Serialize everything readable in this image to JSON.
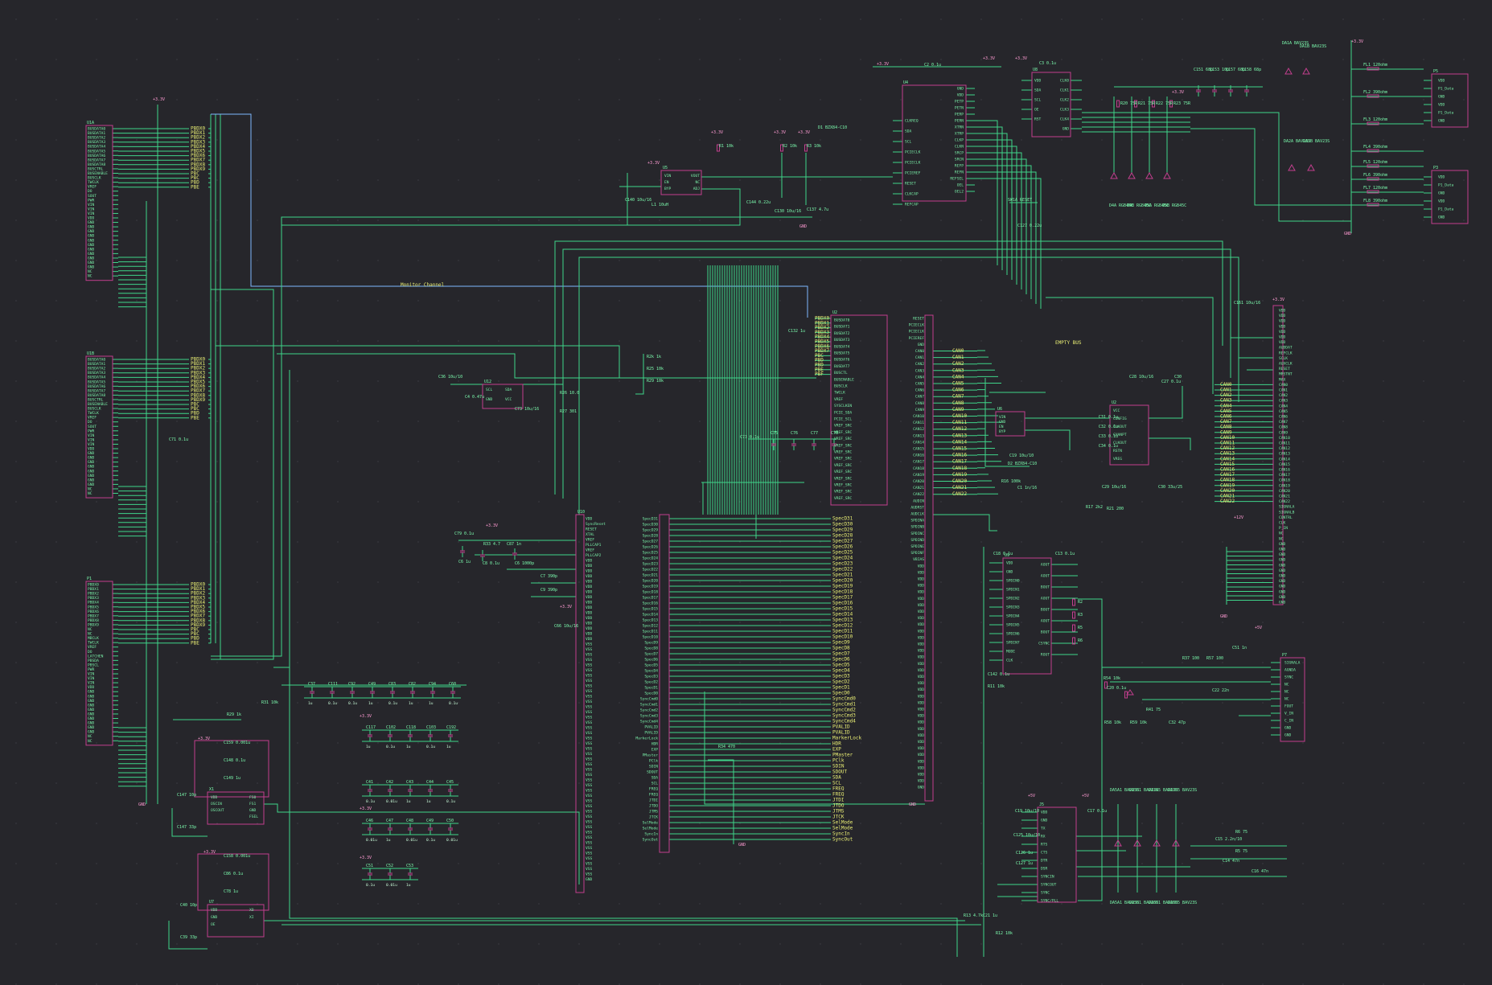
{
  "colors": {
    "background": "#26262b",
    "wire": "#3fd58a",
    "bus": "#7fb8ff",
    "component": "#c23f8e",
    "pin_text": "#79f0a8",
    "ref_text": "#7dffb0",
    "label_text": "#e9ee74",
    "power_text": "#ff9bd3"
  },
  "labels": {
    "monitor_channel": "Monitor Channel",
    "empty_bus": "EMPTY BUS",
    "plus33": "+3.3V",
    "plus5": "+5V",
    "plus12": "+12V",
    "gnd": "GND"
  },
  "power": {
    "top_left": "+3.3V",
    "u4_feed": "+3.3V",
    "reg_left": "+3.3V",
    "r2_feed": "+3.3V",
    "r3_feed": "+3.3V",
    "r4_feed": "+3.3V",
    "r5_feed": "+3.3V",
    "conn_left": "+3.3V",
    "conn_right": "+3.3V",
    "led_feed": "+3.3V",
    "pll_feed": "+3.3V",
    "mcu_feed": "+3.3V",
    "amp_feed": "+5V",
    "amp_feed2": "+5V",
    "p12": "+12V",
    "xtal1": "+3.3V",
    "xtal2": "+3.3V",
    "cap_bank1": "+3.3V",
    "cap_bank2": "+3.3V",
    "cap_bank3": "+3.3V",
    "right_conn": "+3.3V",
    "gnd1": "GND",
    "gnd2": "GND",
    "gnd3": "GND",
    "gnd4": "GND",
    "gnd5": "GND",
    "gnd6": "GND"
  },
  "components": {
    "bus_a": {
      "ref": "U1A",
      "pins": [
        "BUSDATA0",
        "BUSDATA1",
        "BUSDATA2",
        "BUSDATA3",
        "BUSDATA4",
        "BUSDATA5",
        "BUSDATA6",
        "BUSDATA7",
        "BUSDATA8",
        "BUSCTRL",
        "BUSENABLE",
        "BUSCLK",
        "TWCLK",
        "VREF",
        "DO",
        "SOUT",
        "PWR",
        "VIN",
        "VIN",
        "VIN",
        "VDD",
        "GND",
        "GND",
        "GND",
        "GND",
        "GND",
        "GND",
        "GND",
        "GND",
        "GND",
        "GND",
        "GND",
        "NC",
        "NC"
      ]
    },
    "bus_b": {
      "ref": "U1B",
      "pins": [
        "BUSDATA0",
        "BUSDATA1",
        "BUSDATA2",
        "BUSDATA3",
        "BUSDATA4",
        "BUSDATA5",
        "BUSDATA6",
        "BUSDATA7",
        "BUSDATA8",
        "BUSCTRL",
        "BUSENABLE",
        "BUSCLK",
        "TWCLK",
        "VREF",
        "DO",
        "SOUT",
        "PWR",
        "VIN",
        "VIN",
        "VIN",
        "VDD",
        "GND",
        "GND",
        "GND",
        "GND",
        "GND",
        "GND",
        "GND",
        "GND",
        "NC",
        "NC"
      ]
    },
    "bus_c": {
      "ref": "P1",
      "pins": [
        "PBDX0",
        "PBDX1",
        "PBDX2",
        "PBDX3",
        "PBDX4",
        "PBDX5",
        "PBDX6",
        "PBDX7",
        "PBDX8",
        "PBDX9",
        "NC",
        "NC",
        "MBCLK",
        "TWCLK",
        "VREF",
        "DO",
        "LATCHEN",
        "PBSDA",
        "PBSCL",
        "PWR",
        "VIN",
        "VIN",
        "VIN",
        "VDD",
        "GND",
        "GND",
        "GND",
        "GND",
        "GND",
        "GND",
        "GND",
        "GND",
        "GND",
        "GND",
        "NC",
        "NC"
      ]
    },
    "bus_labels_a": [
      "PBDX0",
      "PBDX1",
      "PBDX2",
      "PBDX3",
      "PBDX4",
      "PBDX5",
      "PBDX6",
      "PBDX7",
      "PBDX8",
      "PBDX9",
      "PBC",
      "PBC",
      "PBD",
      "PBE"
    ],
    "bus_labels_b": [
      "PBDX0",
      "PBDX1",
      "PBDX2",
      "PBDX3",
      "PBDX4",
      "PBDX5",
      "PBDX6",
      "PBDX7",
      "PBDX8",
      "PBDX9",
      "PBC",
      "PBC",
      "PBD",
      "PBE"
    ],
    "bus_labels_c": [
      "PBDX0",
      "PBDX1",
      "PBDX2",
      "PBDX3",
      "PBDX4",
      "PBDX5",
      "PBDX6",
      "PBDX7",
      "PBDX8",
      "PBDX9",
      "PBC",
      "PBC",
      "PBD",
      "PBE"
    ],
    "u4": {
      "ref": "U4",
      "pins_left": [
        "CLKREQ",
        "SDA",
        "SCL",
        "PCIECLK",
        "PCIECLK",
        "PCIEREF",
        "RESET",
        "CLKCAP",
        "REFCAP"
      ],
      "pins_right": [
        "GND",
        "VDD",
        "PETP",
        "PETN",
        "PERP",
        "PERN",
        "XTRN",
        "XTRP",
        "CLKP",
        "CLKN",
        "SRCP",
        "SRCN",
        "REFP",
        "REFN",
        "REFSEL",
        "OEL",
        "OEL2"
      ]
    },
    "u8": {
      "ref": "U8",
      "pins_left": [
        "VDD",
        "SDA",
        "SCL",
        "OE",
        "RST"
      ],
      "pins_right": [
        "CLK0",
        "CLK1",
        "CLK2",
        "CLK3",
        "CLK4",
        "GND"
      ]
    },
    "u2": {
      "ref": "U2",
      "pins_left": [
        "PBDX0",
        "PBDX1",
        "PBDX2",
        "PBDX3",
        "PBDX4",
        "PBDX5",
        "PBDX6",
        "PBDX7",
        "PBC",
        "PBD",
        "PBD",
        "PBE",
        "PBF"
      ],
      "pins_right": [
        "BUSDAT0",
        "BUSDAT1",
        "BUSDAT2",
        "BUSDAT3",
        "BUSDAT4",
        "BUSDAT5",
        "BUSDAT6",
        "BUSDAT7",
        "BUSCTL",
        "BUSENABLE",
        "BUSCLK",
        "TWCLK",
        "VREF",
        "SYSCLKEN",
        "PCIE_SDA",
        "PCIE_SCL",
        "VREF_SRC",
        "VREF_SRC",
        "VREF_SRC",
        "VREF_SRC",
        "VREF_SRC",
        "VREF_SRC",
        "VREF_SRC",
        "VREF_SRC",
        "VREF_SRC",
        "VREF_SRC",
        "VREF_SRC",
        "VREF_SRC"
      ]
    },
    "u3": {
      "ref": "U3",
      "pins": [
        "RESET",
        "PCIECLK",
        "PCIECLK",
        "PCIEREF",
        "GND",
        "CAN0",
        "CAN1",
        "CAN2",
        "CAN3",
        "CAN4",
        "CAN5",
        "CAN6",
        "CAN7",
        "CAN8",
        "CAN9",
        "CAN10",
        "CAN11",
        "CAN12",
        "CAN13",
        "CAN14",
        "CAN15",
        "CAN16",
        "CAN17",
        "CAN18",
        "CAN19",
        "CAN20",
        "CAN21",
        "CAN22",
        "AUDIN",
        "AUDRST",
        "AUDCLK",
        "SPDINA",
        "SPDINB",
        "SPDINC",
        "SPDIND",
        "SPDINE",
        "SPDINF",
        "VBIAS",
        "VDD",
        "VDD",
        "VDD",
        "VDD",
        "VDD",
        "VDD",
        "VDD",
        "VDD",
        "VDD",
        "VDD",
        "VDD",
        "VDD",
        "VDD",
        "VDD",
        "VDD",
        "VDD",
        "VDD",
        "VDD",
        "VDD",
        "VDD",
        "VDD",
        "VDD",
        "VDD",
        "VDD",
        "VDD",
        "VDD",
        "VDD",
        "VDD",
        "VDD",
        "VDD",
        "VDD",
        "VDD",
        "VDD",
        "VDD",
        "GND"
      ]
    },
    "u10": {
      "ref": "U10",
      "pins_left": [
        "VDD",
        "SyncReset",
        "RESET",
        "XTAL",
        "VREF",
        "PLLCAP1",
        "VREF",
        "PLLCAP2",
        "VDD",
        "VDD",
        "VDD",
        "VDD",
        "VDD",
        "VDD",
        "VDD",
        "VDD",
        "VDD",
        "VDD",
        "VDD",
        "VDD",
        "VDD",
        "VDD",
        "VDD",
        "VDD",
        "VSS",
        "VSS",
        "VSS",
        "VSS",
        "VSS",
        "VSS",
        "VSS",
        "VSS",
        "VSS",
        "VSS",
        "VSS",
        "VSS",
        "VSS",
        "VSS",
        "VSS",
        "VSS",
        "VSS",
        "VSS",
        "VSS",
        "VSS",
        "VSS",
        "VSS",
        "VSS",
        "VSS",
        "VSS",
        "VSS",
        "VSS",
        "VSS",
        "VSS",
        "VSS",
        "VSS",
        "VSS",
        "VSS",
        "VSS",
        "VSS",
        "VSS",
        "VSS",
        "VSS",
        "VSS",
        "VSS",
        "VSS",
        "VSS",
        "VSS",
        "VSS",
        "VSS",
        "GND"
      ],
      "pins_mid": [
        "SpecD31",
        "SpecD30",
        "SpecD29",
        "SpecD28",
        "SpecD27",
        "SpecD26",
        "SpecD25",
        "SpecD24",
        "SpecD23",
        "SpecD22",
        "SpecD21",
        "SpecD20",
        "SpecD19",
        "SpecD18",
        "SpecD17",
        "SpecD16",
        "SpecD15",
        "SpecD14",
        "SpecD13",
        "SpecD12",
        "SpecD11",
        "SpecD10",
        "SpecD9",
        "SpecD8",
        "SpecD7",
        "SpecD6",
        "SpecD5",
        "SpecD4",
        "SpecD3",
        "SpecD2",
        "SpecD1",
        "SpecD0",
        "SyncCmd0",
        "SyncCmd1",
        "SyncCmd2",
        "SyncCmd3",
        "SyncCmd4",
        "PVALID",
        "PVALID",
        "MarkerLock",
        "HDR",
        "EXP",
        "PMaster",
        "PClk",
        "SDIN",
        "SDOUT",
        "SDA",
        "SCL",
        "FREQ",
        "FREQ",
        "JTDI",
        "JTDO",
        "JTMS",
        "JTCK",
        "SelMode",
        "SelMode",
        "SyncIn",
        "SyncOut"
      ]
    },
    "u5": {
      "ref": "U5",
      "pins_left": [
        "VIN",
        "EN",
        "BYP"
      ],
      "pins_right": [
        "VOUT",
        "NC",
        "ADJ"
      ]
    },
    "u6": {
      "ref": "U6",
      "pins_left": [
        "VIN",
        "EN",
        "BYP"
      ],
      "pins_right": [
        "VOUT",
        "NC",
        "ADJ"
      ]
    },
    "u9": {
      "ref": "U9",
      "pins_left": [
        "VDD",
        "GND",
        "SPDIN0",
        "SPDIN1",
        "SPDIN2",
        "SPDIN3",
        "SPDIN4",
        "SPDIN5",
        "SPDIN6",
        "SPDIN7",
        "MODE",
        "CLK"
      ],
      "pins_right": [
        "AOUT",
        "AOUT",
        "BOUT",
        "AOUT",
        "BOUT",
        "AOUT",
        "BOUT",
        "CSYNC",
        "ROUT"
      ]
    },
    "u11": {
      "ref": "U11",
      "pins_left": [
        "VDD",
        "GND",
        "SDA",
        "SCL",
        "ADDR"
      ],
      "pins_right": [
        "VDD",
        "GND",
        "OUT",
        "OUT2"
      ]
    },
    "u12": {
      "ref": "U12",
      "pins": [
        "SCL",
        "SDA",
        "GND",
        "VCC"
      ]
    },
    "u7": {
      "ref": "U7",
      "pins": [
        "VDD",
        "GND",
        "OE",
        "XO",
        "XI"
      ]
    },
    "x1": {
      "ref": "X1",
      "pins": [
        "VDD",
        "OSCIN",
        "OSCOUT",
        "FSEL",
        "FS0",
        "FS1",
        "GND"
      ]
    },
    "j5": {
      "ref": "J5",
      "pins": [
        "VDD",
        "GND",
        "TX",
        "RX",
        "RTS",
        "CTS",
        "DTR",
        "DSR",
        "SYNCIN",
        "SYNCOUT",
        "SYNC",
        "SYNC/PLL"
      ]
    },
    "p1r": {
      "ref": "P7",
      "pins": [
        "SIGNALA",
        "AGNDA",
        "SYNC",
        "NC",
        "NC",
        "NC",
        "FOUT",
        "V_IN",
        "C_IN",
        "GND",
        "GND"
      ]
    },
    "pbig": {
      "ref": "P2",
      "pins": [
        "VDD",
        "VDD",
        "VDD",
        "VDD",
        "VDD",
        "VDD",
        "VDD",
        "AUDDAT",
        "REFCLK",
        "SCLK",
        "AUXCLK",
        "RESET",
        "MRSTNT",
        "MAX",
        "CAN0",
        "CAN1",
        "CAN2",
        "CAN3",
        "CAN4",
        "CAN5",
        "CAN6",
        "CAN7",
        "CAN8",
        "CAN9",
        "CAN10",
        "CAN11",
        "CAN12",
        "CAN13",
        "CAN14",
        "CAN15",
        "CAN16",
        "CAN17",
        "CAN18",
        "CAN19",
        "CAN20",
        "CAN21",
        "CAN22",
        "SIGNALA",
        "SIGNALB",
        "CONTRL",
        "CLK",
        "P_IN",
        "NC",
        "NC",
        "GND",
        "GND",
        "GND",
        "GND",
        "GND",
        "GND",
        "GND",
        "GND",
        "GND",
        "GND",
        "GND",
        "GND"
      ]
    },
    "j1": {
      "ref": "P5",
      "pins": [
        "VDD",
        "P1_Data",
        "GND",
        "VDD",
        "P1_Data",
        "GND"
      ]
    },
    "j2": {
      "ref": "P3",
      "pins": [
        "VDD",
        "P1_Data",
        "GND",
        "VDD",
        "P1_Data",
        "GND"
      ]
    },
    "ferrites_j1": [
      "FL1 120ohm",
      "FL2 390ohm",
      "FL3 120ohm",
      "FL4 390ohm"
    ],
    "ferrites_j2": [
      "FL5 120ohm",
      "FL6 390ohm",
      "FL7 120ohm",
      "FL8 390ohm"
    ],
    "caps_bank1": [
      "C37",
      "C111",
      "C92",
      "C49",
      "C83",
      "C82",
      "C94",
      "C60"
    ],
    "caps_bank1_val": [
      "1u",
      "0.1u",
      "0.1u",
      "1u",
      "0.1u",
      "1u",
      "1u",
      "0.1u"
    ],
    "caps_bank2": [
      "C117",
      "C102",
      "C118",
      "C103",
      "C192"
    ],
    "caps_bank2_val": [
      "1u",
      "0.1u",
      "1u",
      "0.1u",
      "1u"
    ],
    "caps_bank3": [
      "C41",
      "C42",
      "C43",
      "C44",
      "C45"
    ],
    "caps_bank3_val": [
      "0.1u",
      "0.01u",
      "1u",
      "1u",
      "0.1u"
    ],
    "caps_bank4": [
      "C46",
      "C47",
      "C48",
      "C49",
      "C50"
    ],
    "caps_bank4_val": [
      "0.01u",
      "1u",
      "0.01u",
      "0.1u",
      "0.01u"
    ],
    "caps_bank5": [
      "C51",
      "C52",
      "C53"
    ],
    "caps_bank5_val": [
      "0.1u",
      "0.01u",
      "1u"
    ],
    "diodes_top": [
      "DA1A BAV23S",
      "DA1B BAV23S"
    ],
    "diodes_mid": [
      "DA2A BAV23S",
      "DA2B BAV23S"
    ],
    "diodes_bot": [
      "DA5A1 BAV23S",
      "DA5B1 BAV23S",
      "DA7A5 BAV23S",
      "DA7B5 BAV23S"
    ],
    "diodes_bot2": [
      "DA5A1 BAV23S",
      "DA5B1 BAV23S",
      "DA6B1 BAV23S",
      "DA6B5 BAV23S"
    ],
    "leds": [
      "D4A RGB45C",
      "D4B RGB45C",
      "D5A RGB45C",
      "D5B RGB45C"
    ],
    "res_led": [
      "R20 75R",
      "R21 75R",
      "R22 75R",
      "R23 75R"
    ],
    "caps_top_right": [
      "C151 68p",
      "C153 10p",
      "C157 68p",
      "C158 68p"
    ],
    "misc": {
      "r1": "R1 10k",
      "r2": "R2 10k",
      "r3": "R3 10k",
      "r4": "R4 10k",
      "r5": "R5 10k",
      "d1": "D1 BZX84-C10",
      "d2": "D2 BZX84-C10",
      "sw": "SW1A RESET",
      "r57": "R57 10k",
      "r32": "R32 10k",
      "r60": "R60 1M",
      "r65": "R65 33k",
      "c40": "C40 22p",
      "c41": "C41 22p",
      "c39": "C39 22p",
      "c36": "C36 10u/10",
      "l1": "L1 10uH",
      "c140": "C140 10u/16",
      "c144": "C144 0.22u",
      "c132": "C132 1u",
      "c73": "C73 0.1u",
      "c75": "C75 0.1u",
      "c76": "C76 0.1u",
      "c77": "C77 0.1u",
      "c78": "C78 0.1u",
      "c125": "C125 10u/10",
      "c126": "C126 1u",
      "c127": "C127 1u",
      "c14": "C14 47n",
      "c15": "C15 2.2n/10",
      "c16": "C16 47n",
      "c22": "C22 22n",
      "r29": "R29 1k",
      "r54": "R54 10k",
      "r58": "R58 10k",
      "r59": "R59 10k",
      "r13": "R13 4.7k",
      "c21": "C21 1u",
      "c19": "C19 10u/10",
      "c20": "C20 0.1u",
      "r17": "R17 2k2",
      "r18": "R18 4k7",
      "c29": "C29 10u/16",
      "c30": "C30 33u/25"
    }
  }
}
